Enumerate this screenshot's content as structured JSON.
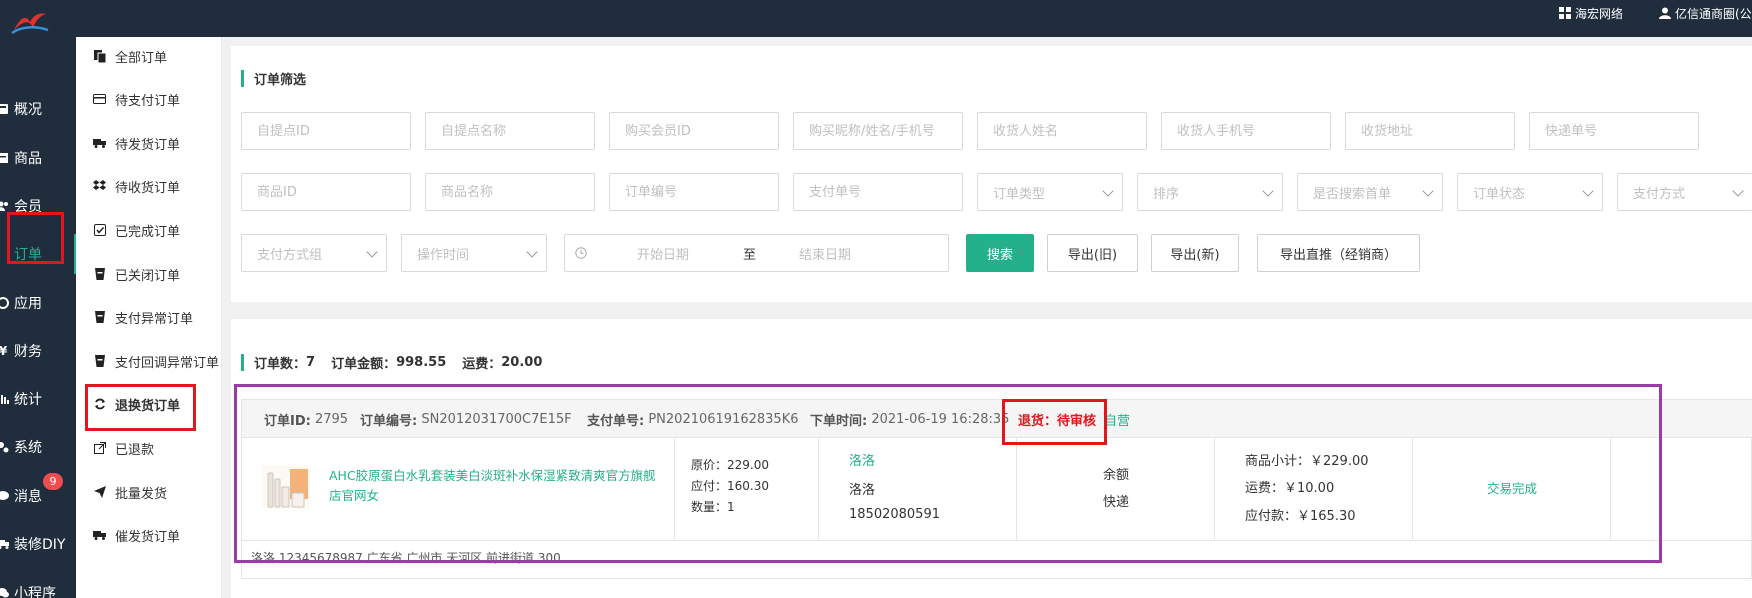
{
  "topbar": {
    "org_name": "海宏网络",
    "user_name": "亿信通商圈(公",
    "colors": {
      "bg": "#1f2d3d",
      "accent": "#24b08a"
    }
  },
  "sidebar": {
    "items": [
      {
        "label": "概况",
        "icon": "dashboard-icon"
      },
      {
        "label": "商品",
        "icon": "goods-icon"
      },
      {
        "label": "会员",
        "icon": "users-icon"
      },
      {
        "label": "订单",
        "icon": "order-icon",
        "active": true
      },
      {
        "label": "应用",
        "icon": "apps-icon"
      },
      {
        "label": "财务",
        "icon": "yen-icon"
      },
      {
        "label": "统计",
        "icon": "chart-icon"
      },
      {
        "label": "系统",
        "icon": "gears-icon"
      },
      {
        "label": "消息",
        "icon": "message-icon",
        "badge": "9"
      },
      {
        "label": "装修DIY",
        "icon": "truck-icon"
      },
      {
        "label": "小程序",
        "icon": "wechat-icon"
      }
    ]
  },
  "subnav": {
    "items": [
      {
        "label": "全部订单",
        "icon": "copy-icon"
      },
      {
        "label": "待支付订单",
        "icon": "credit-card-icon"
      },
      {
        "label": "待发货订单",
        "icon": "truck-icon"
      },
      {
        "label": "待收货订单",
        "icon": "dropbox-icon"
      },
      {
        "label": "已完成订单",
        "icon": "check-square-icon"
      },
      {
        "label": "已关闭订单",
        "icon": "cup-icon"
      },
      {
        "label": "支付异常订单",
        "icon": "cup-icon"
      },
      {
        "label": "支付回调异常订单",
        "icon": "cup-icon"
      },
      {
        "label": "退换货订单",
        "icon": "refresh-icon",
        "active": true
      },
      {
        "label": "已退款",
        "icon": "external-link-icon"
      },
      {
        "label": "批量发货",
        "icon": "send-icon"
      },
      {
        "label": "催发货订单",
        "icon": "truck-icon"
      }
    ]
  },
  "filter": {
    "title": "订单筛选",
    "row1": [
      "自提点ID",
      "自提点名称",
      "购买会员ID",
      "购买昵称/姓名/手机号",
      "收货人姓名",
      "收货人手机号",
      "收货地址",
      "快递单号"
    ],
    "row2_inputs": [
      "商品ID",
      "商品名称",
      "订单编号",
      "支付单号"
    ],
    "row2_selects": [
      "订单类型",
      "排序",
      "是否搜索首单",
      "订单状态",
      "支付方式"
    ],
    "row3_selects": [
      "支付方式组",
      "操作时间"
    ],
    "date_start": "开始日期",
    "date_sep": "至",
    "date_end": "结束日期",
    "buttons": {
      "search": "搜索",
      "export_old": "导出(旧)",
      "export_new": "导出(新)",
      "export_direct": "导出直推（经销商）"
    }
  },
  "summary": {
    "count_label": "订单数：",
    "count": "7",
    "amount_label": "订单金额：",
    "amount": "998.55",
    "freight_label": "运费：",
    "freight": "20.00"
  },
  "order": {
    "id_label": "订单ID:",
    "id": "2795",
    "sn_label": "订单编号:",
    "sn": "SN2012031700C7E15F",
    "pay_label": "支付单号:",
    "pay_no": "PN20210619162835K6",
    "time_label": "下单时间:",
    "time": "2021-06-19 16:28:35",
    "refund_status": "退货：待审核",
    "shop_type": "自营",
    "product_name": "AHC胶原蛋白水乳套装美白淡斑补水保湿紧致清爽官方旗舰店官网女",
    "price_line": "原价：229.00",
    "pay_line": "应付：160.30",
    "qty_line": "数量：1",
    "buyer_nick": "洛洛",
    "buyer_name": "洛洛",
    "buyer_phone": "18502080591",
    "pay_method": "余额",
    "delivery": "快递",
    "subtotal_line": "商品小计：￥229.00",
    "freight_line": "运费：￥10.00",
    "payable_line": "应付款：￥165.30",
    "status": "交易完成",
    "address": "洛洛   12345678987   广东省 广州市 天河区 前进街道 300"
  }
}
